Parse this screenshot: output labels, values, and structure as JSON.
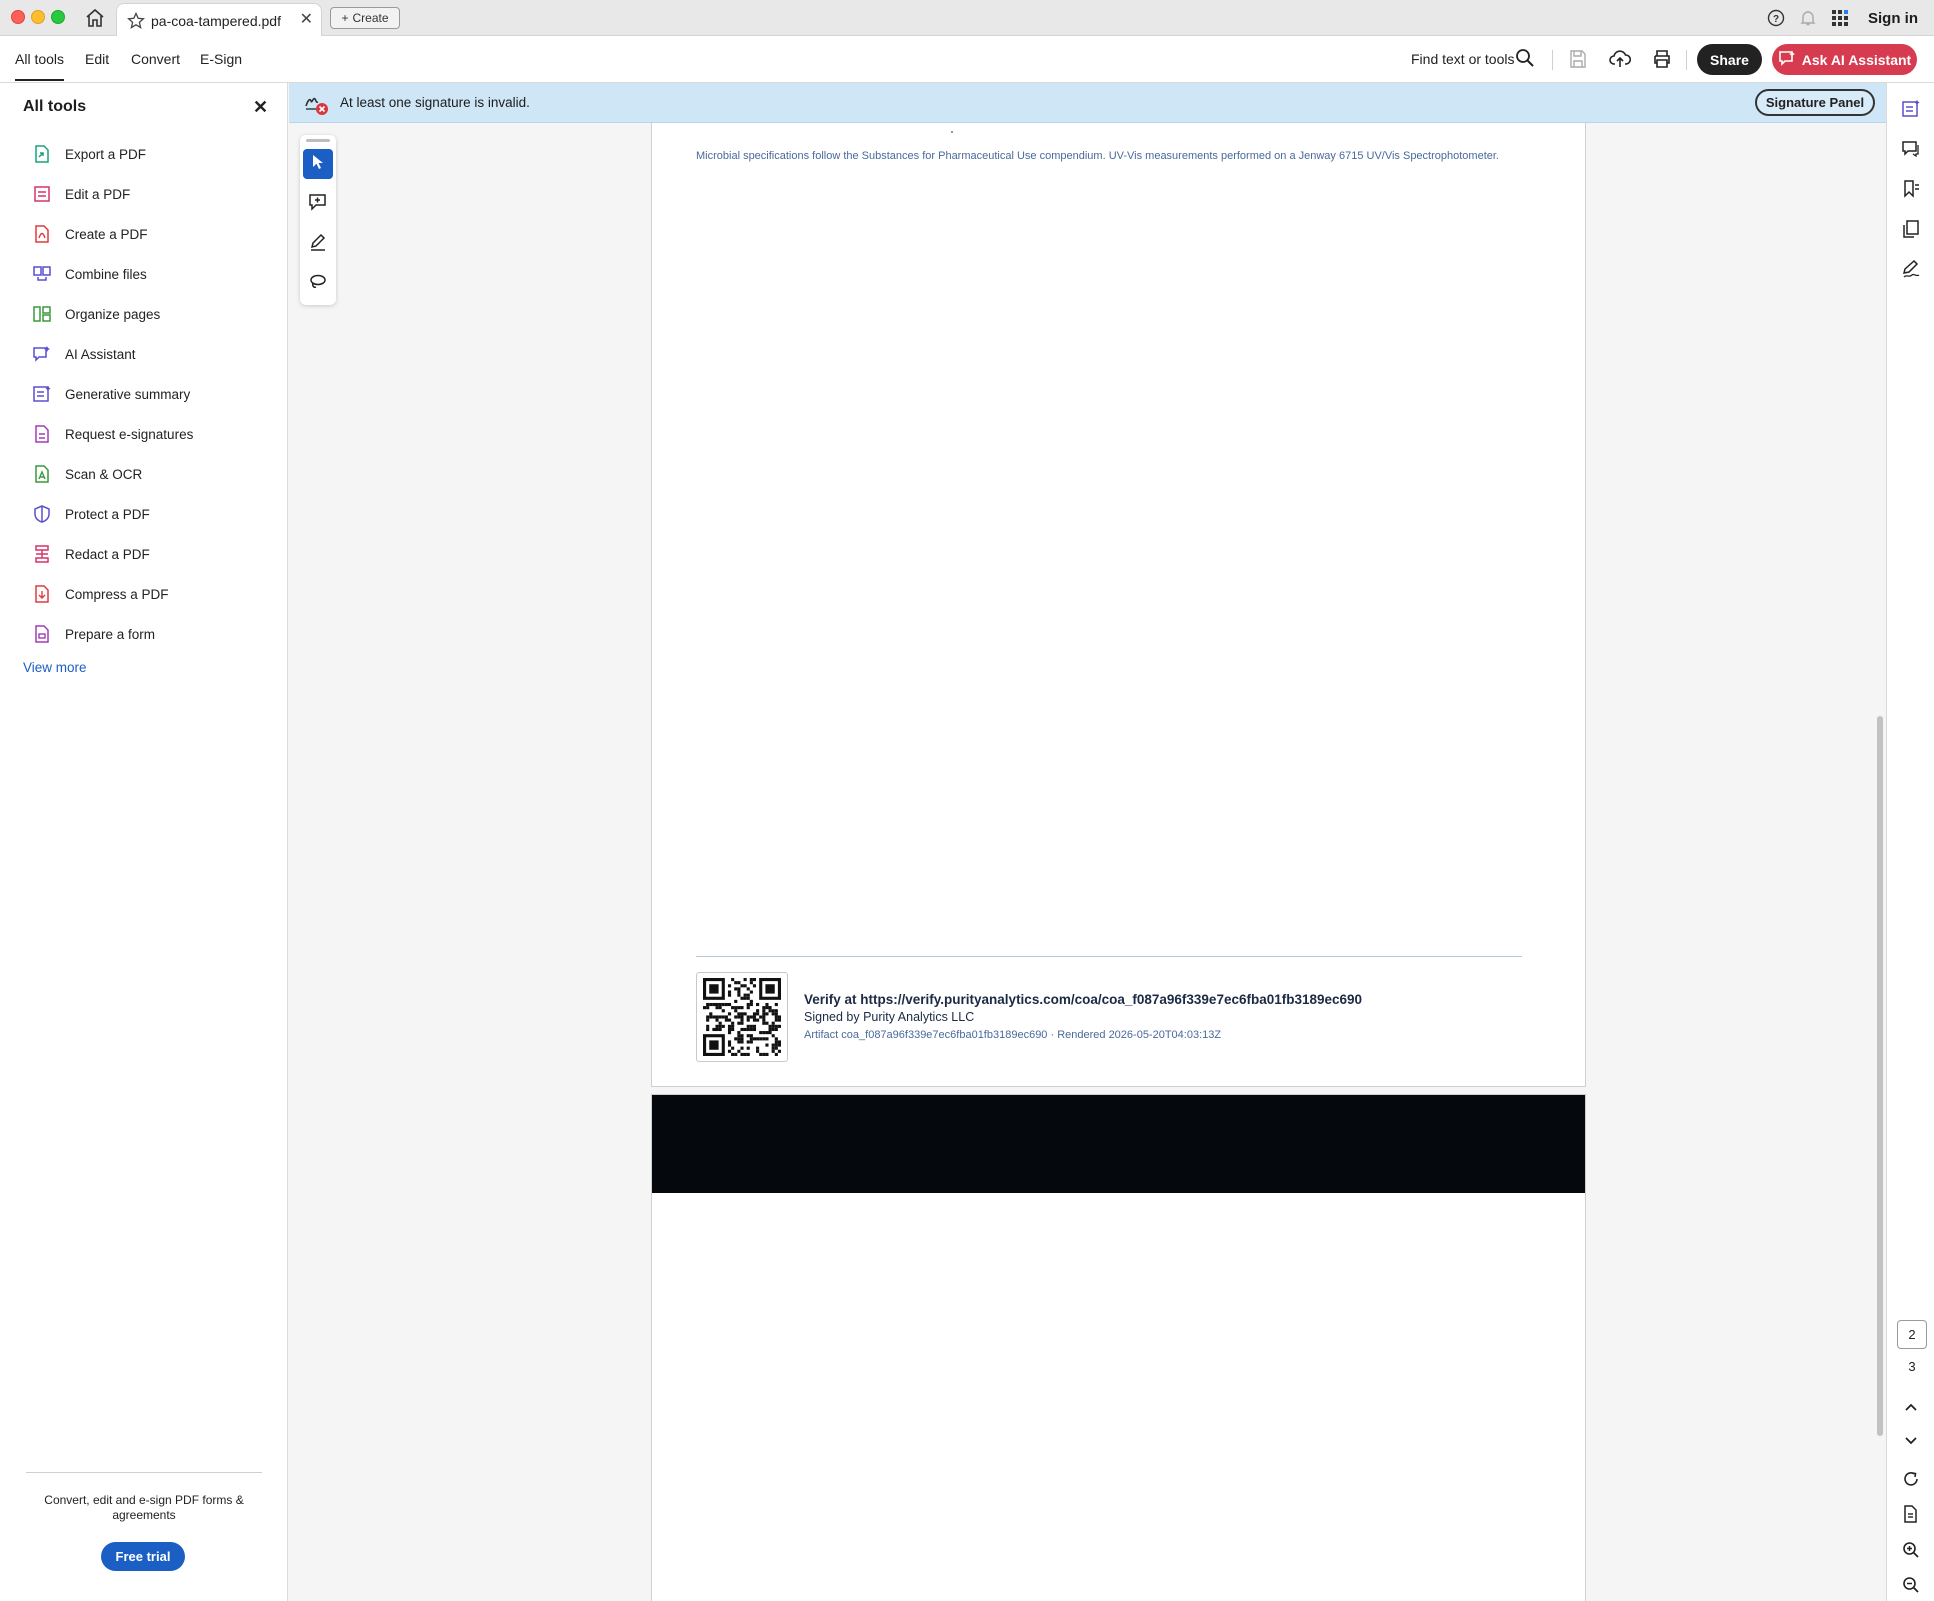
{
  "window": {
    "tab_title": "pa-coa-tampered.pdf",
    "create_label": "Create",
    "sign_in": "Sign in"
  },
  "menubar": {
    "items": [
      "All tools",
      "Edit",
      "Convert",
      "E-Sign"
    ],
    "active": "All tools",
    "find_label": "Find text or tools",
    "share_label": "Share",
    "ai_label": "Ask AI Assistant"
  },
  "left_panel": {
    "title": "All tools",
    "tools": [
      {
        "label": "Export a PDF",
        "icon": "export-pdf-icon",
        "color": "#1aa37a"
      },
      {
        "label": "Edit a PDF",
        "icon": "edit-pdf-icon",
        "color": "#d6346c"
      },
      {
        "label": "Create a PDF",
        "icon": "create-pdf-icon",
        "color": "#e03a3e"
      },
      {
        "label": "Combine files",
        "icon": "combine-files-icon",
        "color": "#5a4fcf"
      },
      {
        "label": "Organize pages",
        "icon": "organize-pages-icon",
        "color": "#3a9a3a"
      },
      {
        "label": "AI Assistant",
        "icon": "ai-assistant-icon",
        "color": "#5a4fcf"
      },
      {
        "label": "Generative summary",
        "icon": "generative-summary-icon",
        "color": "#5a4fcf"
      },
      {
        "label": "Request e-signatures",
        "icon": "request-esignatures-icon",
        "color": "#a33bb8"
      },
      {
        "label": "Scan & OCR",
        "icon": "scan-ocr-icon",
        "color": "#3a9a3a"
      },
      {
        "label": "Protect a PDF",
        "icon": "protect-pdf-icon",
        "color": "#5a4fcf"
      },
      {
        "label": "Redact a PDF",
        "icon": "redact-pdf-icon",
        "color": "#d6346c"
      },
      {
        "label": "Compress a PDF",
        "icon": "compress-pdf-icon",
        "color": "#e03a3e"
      },
      {
        "label": "Prepare a form",
        "icon": "prepare-form-icon",
        "color": "#a33bb8"
      }
    ],
    "view_more": "View more",
    "footer_text": "Convert, edit and e-sign PDF forms & agreements",
    "trial_label": "Free trial"
  },
  "banner": {
    "message": "At least one signature is invalid.",
    "button_label": "Signature Panel"
  },
  "document": {
    "note": "Microbial specifications follow the Substances for Pharmaceutical Use compendium. UV-Vis measurements performed on a Jenway 6715 UV/Vis Spectrophotometer.",
    "verify_text": "Verify at https://verify.purityanalytics.com/coa/coa_f087a96f339e7ec6fba01fb3189ec690",
    "signed_by": "Signed by Purity Analytics LLC",
    "artifact": "Artifact coa_f087a96f339e7ec6fba01fb3189ec690 · Rendered 2026-05-20T04:03:13Z"
  },
  "page_nav": {
    "current": "2",
    "total": "3"
  },
  "colors": {
    "accent": "#1b5fc4",
    "ai_button": "#d73b4f",
    "banner": "#cfe6f7"
  }
}
